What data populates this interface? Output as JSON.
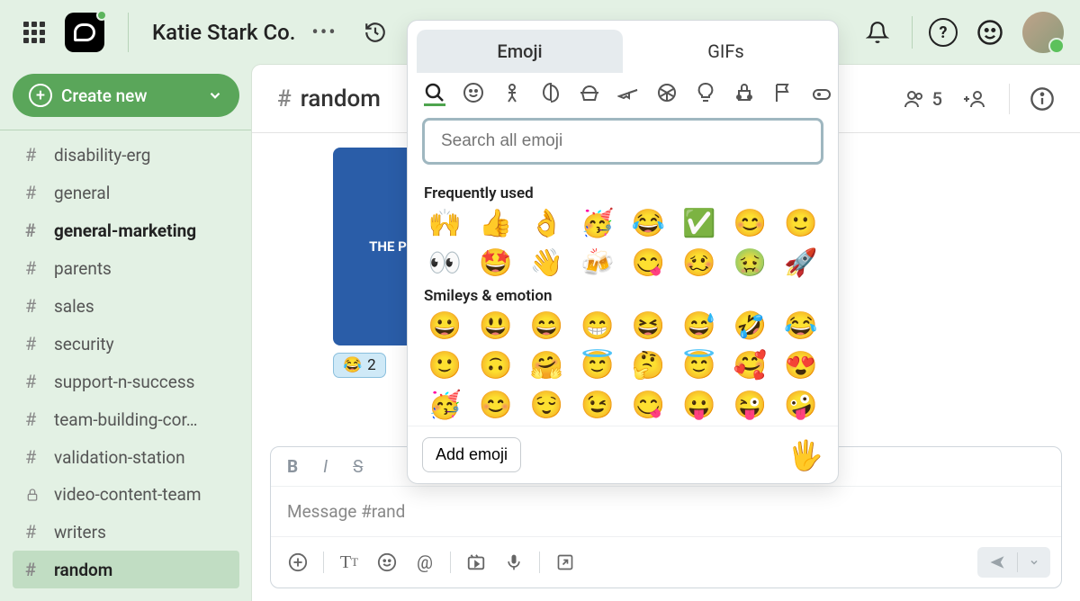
{
  "header": {
    "workspace": "Katie Stark Co."
  },
  "sidebar": {
    "create_label": "Create new",
    "channels": [
      {
        "name": "disability-erg",
        "bold": false,
        "private": false,
        "active": false
      },
      {
        "name": "general",
        "bold": false,
        "private": false,
        "active": false
      },
      {
        "name": "general-marketing",
        "bold": true,
        "private": false,
        "active": false
      },
      {
        "name": "parents",
        "bold": false,
        "private": false,
        "active": false
      },
      {
        "name": "sales",
        "bold": false,
        "private": false,
        "active": false
      },
      {
        "name": "security",
        "bold": false,
        "private": false,
        "active": false
      },
      {
        "name": "support-n-success",
        "bold": false,
        "private": false,
        "active": false
      },
      {
        "name": "team-building-cor…",
        "bold": false,
        "private": false,
        "active": false
      },
      {
        "name": "validation-station",
        "bold": false,
        "private": false,
        "active": false
      },
      {
        "name": "video-content-team",
        "bold": false,
        "private": true,
        "active": false
      },
      {
        "name": "writers",
        "bold": false,
        "private": false,
        "active": false
      },
      {
        "name": "random",
        "bold": false,
        "private": false,
        "active": true
      }
    ]
  },
  "channel_header": {
    "name": "random",
    "member_count": "5"
  },
  "message": {
    "image_text": "THE PRE CONN",
    "reaction_emoji": "😂",
    "reaction_count": "2"
  },
  "composer": {
    "placeholder": "Message #rand"
  },
  "emoji_picker": {
    "tabs": {
      "emoji": "Emoji",
      "gifs": "GIFs"
    },
    "search_placeholder": "Search all emoji",
    "sections": {
      "frequent_title": "Frequently used",
      "frequent": [
        "🙌",
        "👍",
        "👌",
        "🥳",
        "😂",
        "✅",
        "😊",
        "🙂",
        "👀",
        "🤩",
        "👋",
        "🍻",
        "😋",
        "🥴",
        "🤢",
        "🚀"
      ],
      "smileys_title": "Smileys & emotion",
      "smileys": [
        "😀",
        "😃",
        "😄",
        "😁",
        "😆",
        "😅",
        "🤣",
        "😂",
        "🙂",
        "🙃",
        "🤗",
        "😇",
        "🤔",
        "😇",
        "🥰",
        "😍",
        "🥳",
        "😊",
        "😌",
        "😉",
        "😋",
        "😛",
        "😜",
        "🤪"
      ]
    },
    "add_label": "Add emoji",
    "preview": "🖐️"
  }
}
